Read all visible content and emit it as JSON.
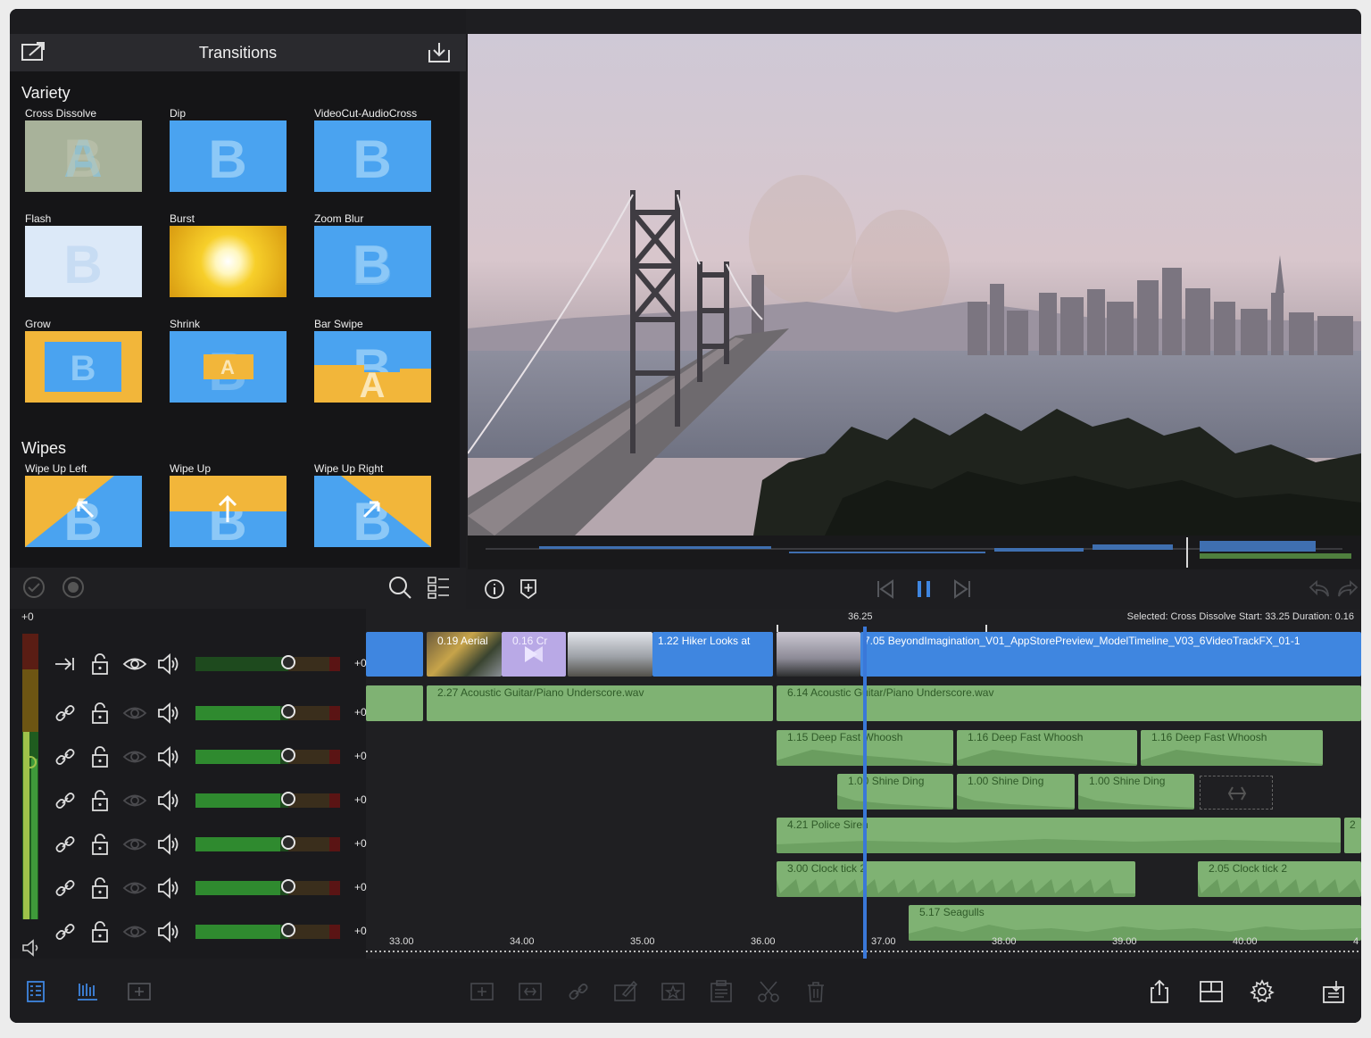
{
  "panel": {
    "title": "Transitions",
    "sections": [
      {
        "title": "Variety",
        "items": [
          {
            "label": "Cross Dissolve",
            "letter": "A"
          },
          {
            "label": "Dip",
            "letter": "B"
          },
          {
            "label": "VideoCut-AudioCross",
            "letter": "B"
          },
          {
            "label": "Flash",
            "letter": "B"
          },
          {
            "label": "Burst",
            "letter": ""
          },
          {
            "label": "Zoom Blur",
            "letter": "B"
          },
          {
            "label": "Grow",
            "letter": "B"
          },
          {
            "label": "Shrink",
            "letter": "A"
          },
          {
            "label": "Bar Swipe",
            "letter": ""
          }
        ]
      },
      {
        "title": "Wipes",
        "items": [
          {
            "label": "Wipe Up Left",
            "letter": ""
          },
          {
            "label": "Wipe Up",
            "letter": ""
          },
          {
            "label": "Wipe Up Right",
            "letter": ""
          }
        ]
      }
    ]
  },
  "colors": {
    "accent": "#3f86e0",
    "audio_clip": "#7fb273",
    "transition_yellow": "#f2b63a",
    "transition_blue": "#4aa3f0"
  },
  "timeline": {
    "master_value": "+0",
    "playhead_time": "36.25",
    "status": "Selected: Cross Dissolve Start: 33.25 Duration: 0.16",
    "tracks": [
      {
        "value": "+0",
        "level": 0.63
      },
      {
        "value": "+0",
        "level": 0.63
      },
      {
        "value": "+0",
        "level": 0.63
      },
      {
        "value": "+0",
        "level": 0.63
      },
      {
        "value": "+0",
        "level": 0.63
      },
      {
        "value": "+0",
        "level": 0.63
      },
      {
        "value": "+0",
        "level": 0.63
      }
    ],
    "clips": {
      "v1": "0.19  Aerial",
      "v2": "0.16  Cr",
      "v3": "1.22  Hiker Looks at",
      "v4": "7.05  BeyondImagination_V01_AppStorePreview_ModelTimeline_V03_6VideoTrackFX_01-1",
      "a1": "2.27  Acoustic Guitar/Piano Underscore.wav",
      "a2": "6.14  Acoustic Guitar/Piano Underscore.wav",
      "w1": "1.15  Deep Fast Whoosh",
      "w2": "1.16  Deep Fast Whoosh",
      "w3": "1.16  Deep Fast Whoosh",
      "s1": "1.00  Shine Ding",
      "s2": "1.00  Shine Ding",
      "s3": "1.00  Shine Ding",
      "p1": "4.21  Police Siren",
      "p2": "2",
      "c1": "3.00  Clock tick 2",
      "c2": "2.05  Clock tick 2",
      "g1": "5.17  Seagulls"
    },
    "ruler": [
      "33.00",
      "34.00",
      "35.00",
      "36.00",
      "37.00",
      "38.00",
      "39.00",
      "40.00",
      "4"
    ]
  }
}
